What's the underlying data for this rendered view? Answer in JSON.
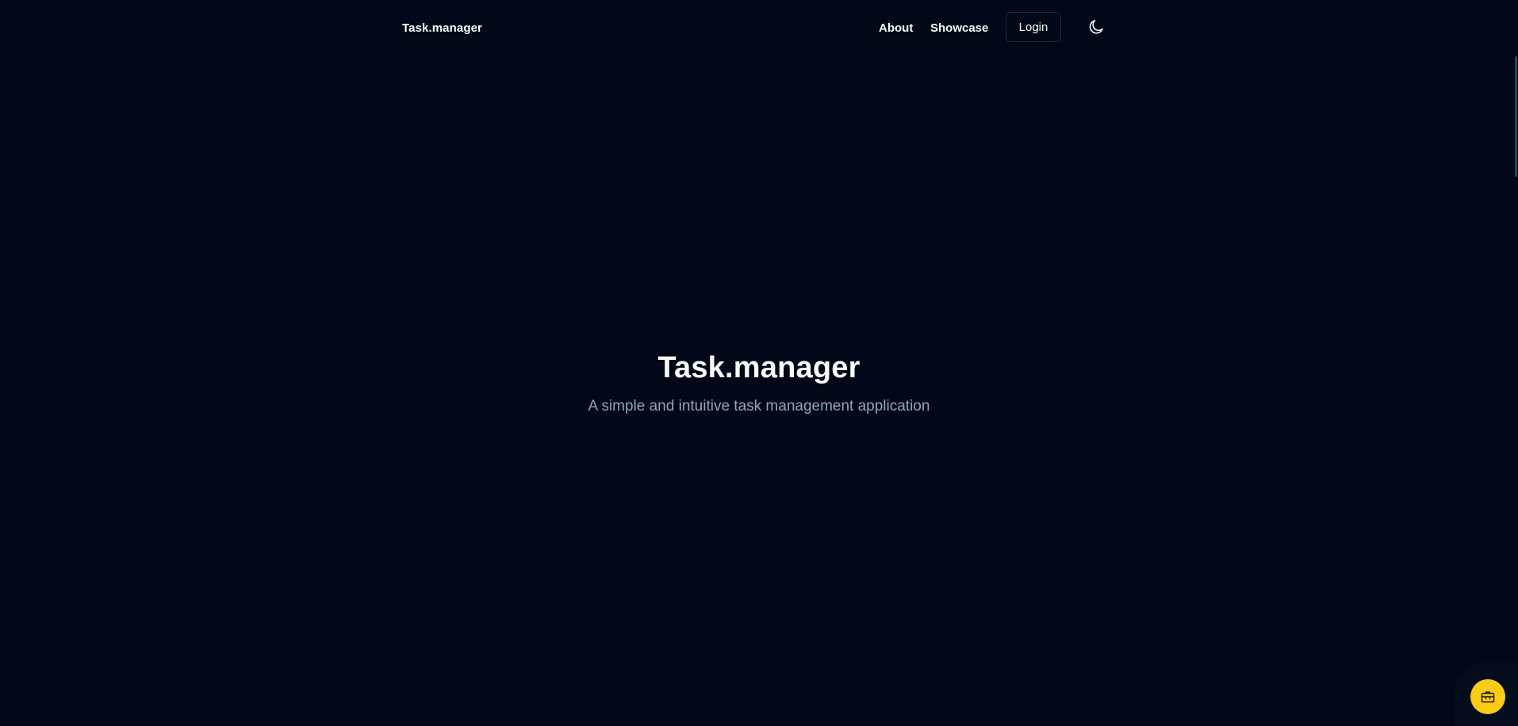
{
  "navbar": {
    "brand": "Task.manager",
    "links": [
      {
        "label": "About"
      },
      {
        "label": "Showcase"
      }
    ],
    "login_label": "Login",
    "theme_toggle_icon": "moon-icon"
  },
  "hero": {
    "title": "Task.manager",
    "subtitle": "A simple and intuitive task management application"
  },
  "floating_button": {
    "icon": "toolbox-icon",
    "color": "#facc15"
  },
  "colors": {
    "background": "#020817",
    "text": "#f8fafc",
    "muted_text": "#94a3b8",
    "border": "#1e293b",
    "accent": "#facc15"
  }
}
